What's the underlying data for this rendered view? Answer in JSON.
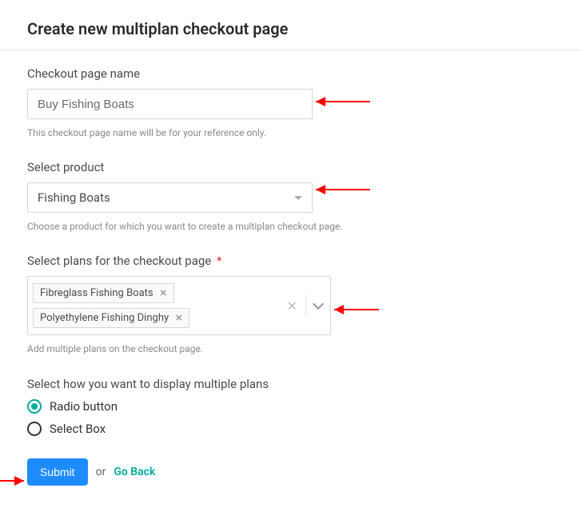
{
  "title": "Create new multiplan checkout page",
  "name_field": {
    "label": "Checkout page name",
    "value": "Buy Fishing Boats",
    "help": "This checkout page name will be for your reference only."
  },
  "product_field": {
    "label": "Select product",
    "value": "Fishing Boats",
    "help": "Choose a product for which you want to create a multiplan checkout page."
  },
  "plans_field": {
    "label": "Select plans for the checkout page",
    "required_mark": "*",
    "chips": [
      "Fibreglass Fishing Boats",
      "Polyethylene Fishing Dinghy"
    ],
    "help": "Add multiple plans on the checkout page."
  },
  "display_field": {
    "label": "Select how you want to display multiple plans",
    "options": [
      {
        "label": "Radio button",
        "checked": true
      },
      {
        "label": "Select Box",
        "checked": false
      }
    ]
  },
  "actions": {
    "submit": "Submit",
    "or": "or",
    "go_back": "Go Back"
  }
}
